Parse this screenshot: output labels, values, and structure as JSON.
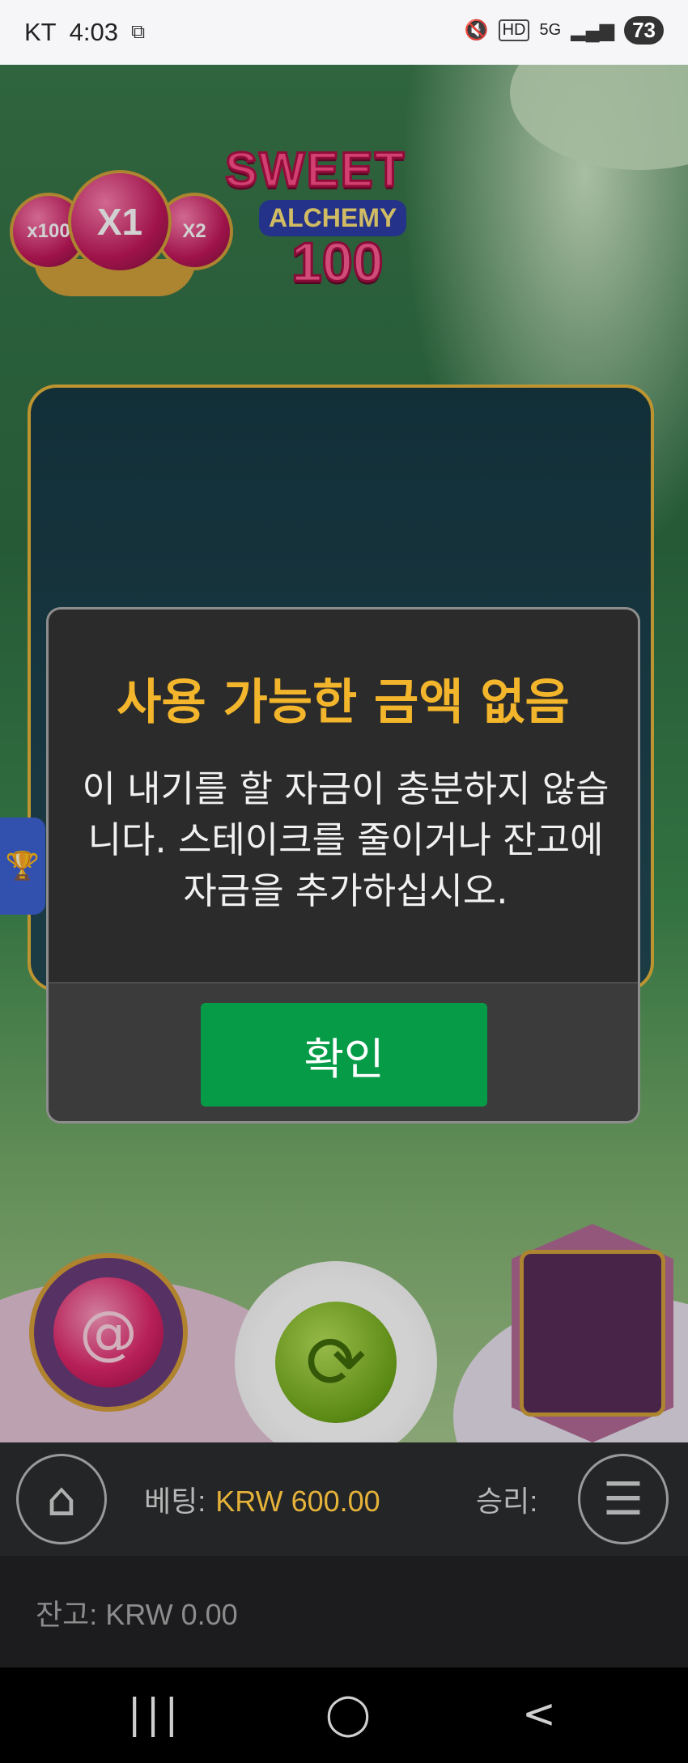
{
  "status_bar": {
    "carrier": "KT",
    "time": "4:03",
    "network": "5G",
    "battery": "73",
    "hd_label": "HD"
  },
  "game": {
    "logo": {
      "line1": "SWEET",
      "line2": "ALCHEMY",
      "line3": "100"
    },
    "multipliers": [
      "x100",
      "X1",
      "X2"
    ]
  },
  "dialog": {
    "title": "사용 가능한 금액 없음",
    "message": "이 내기를 할 자금이 충분하지 않습니다. 스테이크를 줄이거나 잔고에 자금을 추가하십시오.",
    "confirm_label": "확인"
  },
  "bottom_bar": {
    "bet_label": "베팅:",
    "bet_value": "KRW 600.00",
    "win_label": "승리:",
    "balance_label": "잔고:",
    "balance_value": "KRW 0.00"
  },
  "icons": {
    "home": "home-icon",
    "menu": "hamburger-menu-icon",
    "spin": "spin-icon",
    "trophy": "trophy-icon"
  },
  "colors": {
    "accent_gold": "#f3b52b",
    "confirm_green": "#069c47",
    "bet_value": "#e5b23a"
  }
}
